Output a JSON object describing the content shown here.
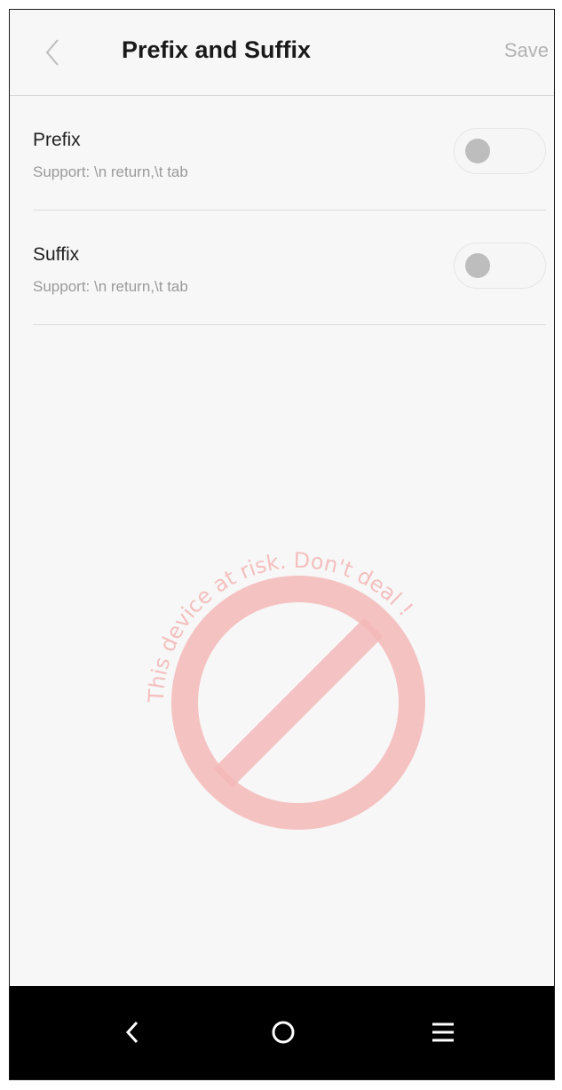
{
  "header": {
    "title": "Prefix and Suffix",
    "save_label": "Save"
  },
  "settings": [
    {
      "title": "Prefix",
      "subtitle": "Support: \\n return,\\t tab",
      "enabled": false
    },
    {
      "title": "Suffix",
      "subtitle": "Support: \\n return,\\t tab",
      "enabled": false
    }
  ],
  "watermark": {
    "text": "This device at risk. Don't deal !",
    "color": "#f2b3b3"
  },
  "navbar": {
    "buttons": [
      "back-icon",
      "home-icon",
      "menu-icon"
    ]
  },
  "colors": {
    "background": "#f7f7f7",
    "title": "#1a1a1a",
    "save_disabled": "#b3b3b3",
    "subtitle": "#9a9a9a",
    "toggle_knob_off": "#bdbdbd",
    "navbar": "#000000"
  }
}
